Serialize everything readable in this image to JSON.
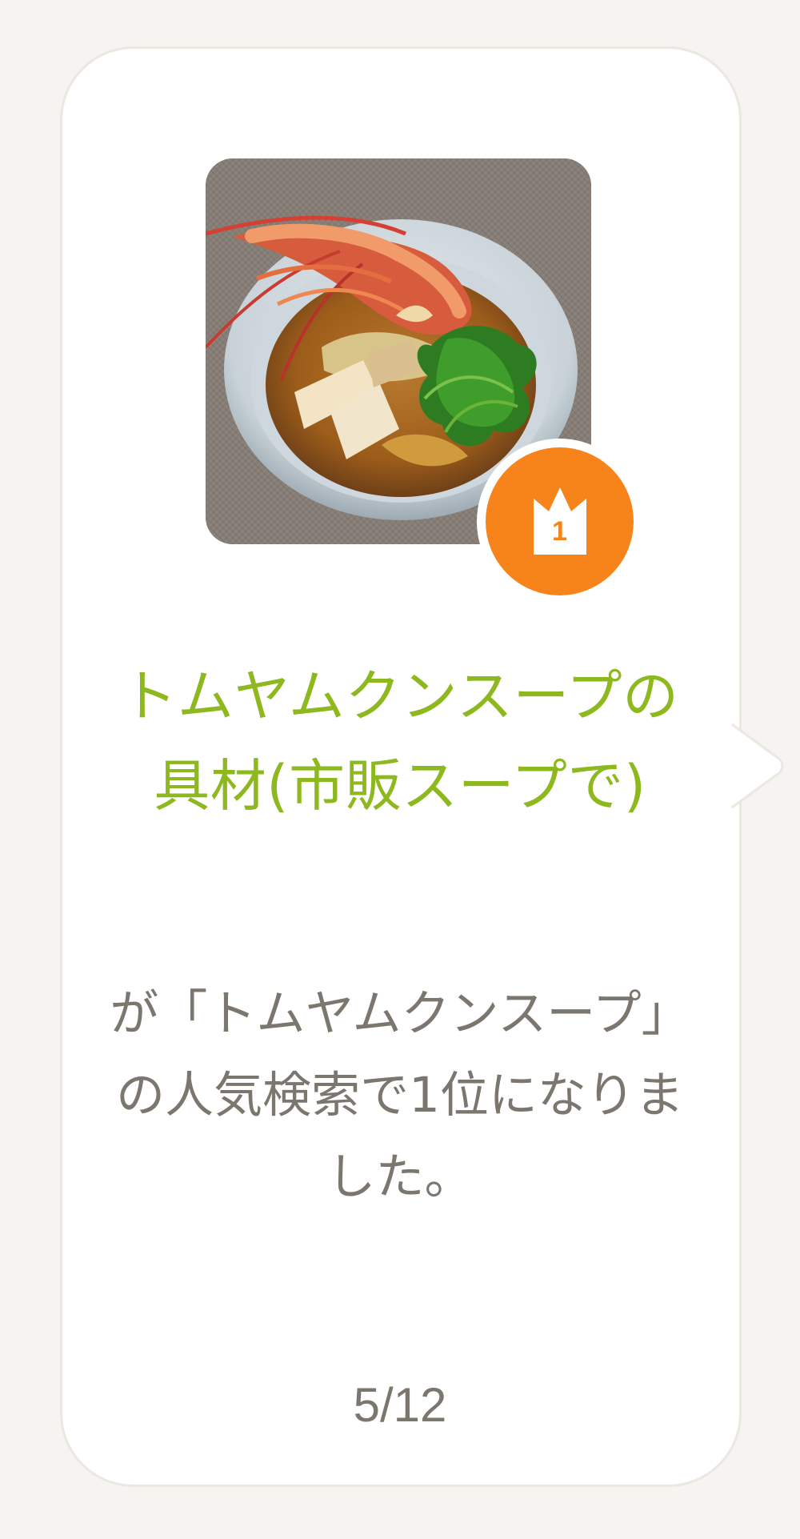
{
  "recipe": {
    "title": "トムヤムクンスープの具材(市販スープで)",
    "image_alt": "トムヤムクンスープの具材(市販スープで)"
  },
  "rank": {
    "number": "1",
    "icon": "crown-icon",
    "badge_color": "#f7831b"
  },
  "message": "が「トムヤムクンスープ」の人気検索で1位になりました。",
  "pagination": {
    "text": "5/12",
    "current": 5,
    "total": 12
  },
  "colors": {
    "title": "#8db91f",
    "text": "#7b766e",
    "background": "#f6f4f0",
    "card": "#ffffff"
  }
}
